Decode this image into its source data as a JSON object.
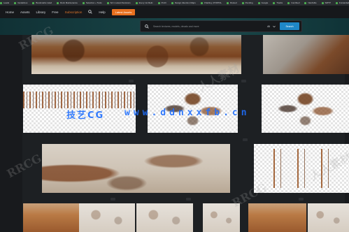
{
  "bookmarks": [
    "Leads",
    "Guidelines",
    "Bookmarks rated",
    "Rock Maintenance",
    "Selection + Tools",
    "Sd 1 Latest Revisions",
    "Every 1st Relic",
    "Profit",
    "Design Attention Maps",
    "Chatting | PORTAL",
    "Rusted",
    "Pending",
    "Google",
    "Tracks",
    "Inscribed",
    "Nashville",
    "SMTP",
    "Forwarded"
  ],
  "nav": {
    "items": [
      "Home",
      "Assets",
      "Library",
      "Free",
      "Subscription",
      "Help"
    ],
    "cta": "Latest Assets"
  },
  "search": {
    "placeholder": "Search textures, models, decals and more",
    "scope": "All",
    "button": "Search"
  },
  "watermark": {
    "cn": "技艺CG",
    "url": "www.ddnxxfb.cn",
    "ghost_a": "RRCG",
    "ghost_b": "人人素材"
  },
  "accent_colors": {
    "cta": "#e8701f",
    "search_button": "#1f87c7",
    "watermark": "#1f6fff"
  }
}
